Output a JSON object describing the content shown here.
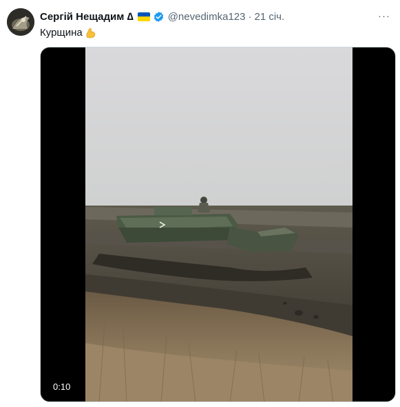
{
  "tweet": {
    "display_name": "Сергій Нещадим ∆",
    "handle": "@nevedimka123",
    "separator": "·",
    "timestamp": "21 січ.",
    "text": "Курщина",
    "emoji_icon": "flexed-biceps-icon",
    "flag_icon": "ukraine-flag-icon",
    "verified_icon": "verified-badge-icon",
    "more_icon": "more-options-icon",
    "more_label": "···"
  },
  "media": {
    "type": "video",
    "duration": "0:10"
  },
  "colors": {
    "verified": "#1d9bf0",
    "flag_top": "#0057b7",
    "flag_bottom": "#ffd700",
    "secondary_text": "#536471"
  }
}
